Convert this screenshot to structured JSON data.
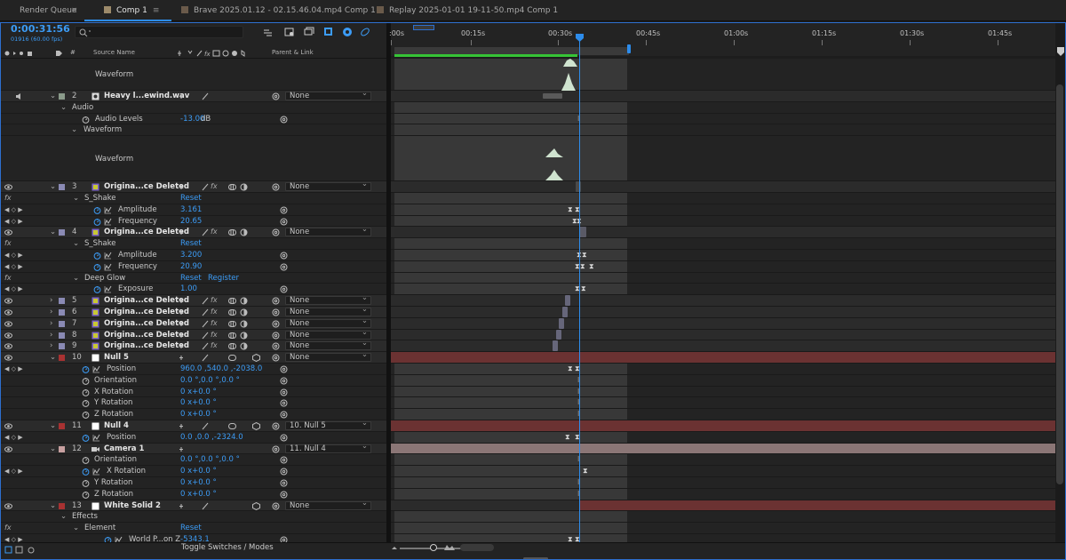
{
  "tabs": [
    {
      "label": "Render Queue",
      "active": false
    },
    {
      "label": "Comp 1",
      "active": true
    },
    {
      "label": "Brave 2025.01.12 - 02.15.46.04.mp4 Comp 1",
      "active": false
    },
    {
      "label": "Replay 2025-01-01 19-11-50.mp4 Comp 1",
      "active": false
    }
  ],
  "timecode": "0:00:31:56",
  "fps_line": "01916 (60.00 fps)",
  "search": {
    "placeholder": ""
  },
  "columns": {
    "hash": "#",
    "source_name": "Source Name",
    "parent_link": "Parent & Link"
  },
  "ruler_ticks": [
    ":00s",
    "00:15s",
    "00:30s",
    "00:45s",
    "01:00s",
    "01:15s",
    "01:30s",
    "01:45s"
  ],
  "toggle_label": "Toggle Switches / Modes",
  "colors": {
    "accent": "#2d8ceb",
    "value_blue": "#3c9cf6",
    "workarea_green": "#36c436",
    "null_track": "#6b3232",
    "camera_track": "#8b7676"
  },
  "rows": [
    {
      "kind": "tall",
      "label": "Waveform",
      "h": 36
    },
    {
      "kind": "layer",
      "num": "2",
      "name": "Heavy l...ewind.wav",
      "parent": "None",
      "color": "#8a9a8a",
      "icon": "audio",
      "audio": true
    },
    {
      "kind": "group",
      "label": "Audio",
      "indent": 1
    },
    {
      "kind": "prop",
      "label": "Audio Levels",
      "value": "-13.00",
      "unit": " dB",
      "indent": 2
    },
    {
      "kind": "group",
      "label": "Waveform",
      "indent": 2
    },
    {
      "kind": "tall",
      "label": "Waveform",
      "h": 51
    },
    {
      "kind": "layer",
      "num": "3",
      "name": "Origina...ce Deleted",
      "parent": "None",
      "color": "#8a8ab4",
      "icon": "precomp",
      "fx": true
    },
    {
      "kind": "effect",
      "label": "S_Shake",
      "reset": "Reset"
    },
    {
      "kind": "prop",
      "label": "Amplitude",
      "value": "3.161",
      "indent": 3,
      "graph": true,
      "keyed": true
    },
    {
      "kind": "prop",
      "label": "Frequency",
      "value": "20.65",
      "indent": 3,
      "graph": true,
      "keyed": true
    },
    {
      "kind": "layer",
      "num": "4",
      "name": "Origina...ce Deleted",
      "parent": "None",
      "color": "#8a8ab4",
      "icon": "precomp",
      "fx": true
    },
    {
      "kind": "effect",
      "label": "S_Shake",
      "reset": "Reset"
    },
    {
      "kind": "prop",
      "label": "Amplitude",
      "value": "3.200",
      "indent": 3,
      "graph": true,
      "keyed": true
    },
    {
      "kind": "prop",
      "label": "Frequency",
      "value": "20.90",
      "indent": 3,
      "graph": true,
      "keyed": true
    },
    {
      "kind": "effect",
      "label": "Deep Glow",
      "reset": "Reset",
      "register": "Register"
    },
    {
      "kind": "prop",
      "label": "Exposure",
      "value": "1.00",
      "indent": 3,
      "graph": true,
      "keyed": true
    },
    {
      "kind": "layer",
      "num": "5",
      "name": "Origina...ce Deleted",
      "parent": "None",
      "color": "#8a8ab4",
      "icon": "precomp",
      "fx": true,
      "collapsed": true
    },
    {
      "kind": "layer",
      "num": "6",
      "name": "Origina...ce Deleted",
      "parent": "None",
      "color": "#8a8ab4",
      "icon": "precomp",
      "fx": true,
      "collapsed": true
    },
    {
      "kind": "layer",
      "num": "7",
      "name": "Origina...ce Deleted",
      "parent": "None",
      "color": "#8a8ab4",
      "icon": "precomp",
      "fx": true,
      "collapsed": true
    },
    {
      "kind": "layer",
      "num": "8",
      "name": "Origina...ce Deleted",
      "parent": "None",
      "color": "#8a8ab4",
      "icon": "precomp",
      "fx": true,
      "collapsed": true
    },
    {
      "kind": "layer",
      "num": "9",
      "name": "Origina...ce Deleted",
      "parent": "None",
      "color": "#8a8ab4",
      "icon": "precomp",
      "fx": true,
      "collapsed": true
    },
    {
      "kind": "layer",
      "num": "10",
      "name": "Null 5",
      "parent": "None",
      "color": "#a83232",
      "icon": "null"
    },
    {
      "kind": "prop",
      "label": "Position",
      "value": "960.0 ,540.0 ,-2038.0",
      "indent": 2,
      "graph": true,
      "keyed": true
    },
    {
      "kind": "prop",
      "label": "Orientation",
      "value": "0.0 °,0.0 °,0.0 °",
      "indent": 2
    },
    {
      "kind": "prop",
      "label": "X Rotation",
      "value": "0 x+0.0 °",
      "indent": 2
    },
    {
      "kind": "prop",
      "label": "Y Rotation",
      "value": "0 x+0.0 °",
      "indent": 2
    },
    {
      "kind": "prop",
      "label": "Z Rotation",
      "value": "0 x+0.0 °",
      "indent": 2
    },
    {
      "kind": "layer",
      "num": "11",
      "name": "Null 4",
      "parent": "10. Null 5",
      "color": "#a83232",
      "icon": "null"
    },
    {
      "kind": "prop",
      "label": "Position",
      "value": "0.0 ,0.0 ,-2324.0",
      "indent": 2,
      "graph": true,
      "keyed": true
    },
    {
      "kind": "layer",
      "num": "12",
      "name": "Camera 1",
      "parent": "11. Null 4",
      "color": "#c8a0a0",
      "icon": "camera"
    },
    {
      "kind": "prop",
      "label": "Orientation",
      "value": "0.0 °,0.0 °,0.0 °",
      "indent": 2
    },
    {
      "kind": "prop",
      "label": "X Rotation",
      "value": "0 x+0.0 °",
      "indent": 2,
      "graph": true,
      "keyed": true
    },
    {
      "kind": "prop",
      "label": "Y Rotation",
      "value": "0 x+0.0 °",
      "indent": 2
    },
    {
      "kind": "prop",
      "label": "Z Rotation",
      "value": "0 x+0.0 °",
      "indent": 2
    },
    {
      "kind": "layer",
      "num": "13",
      "name": "White Solid 2",
      "parent": "None",
      "color": "#a83232",
      "icon": "solid"
    },
    {
      "kind": "group",
      "label": "Effects",
      "indent": 1
    },
    {
      "kind": "effect",
      "label": "Element",
      "reset": "Reset",
      "indent": 2
    },
    {
      "kind": "prop",
      "label": "World P...on Z",
      "value": "-5343.1",
      "indent": 4,
      "graph": true,
      "keyed": true
    }
  ]
}
